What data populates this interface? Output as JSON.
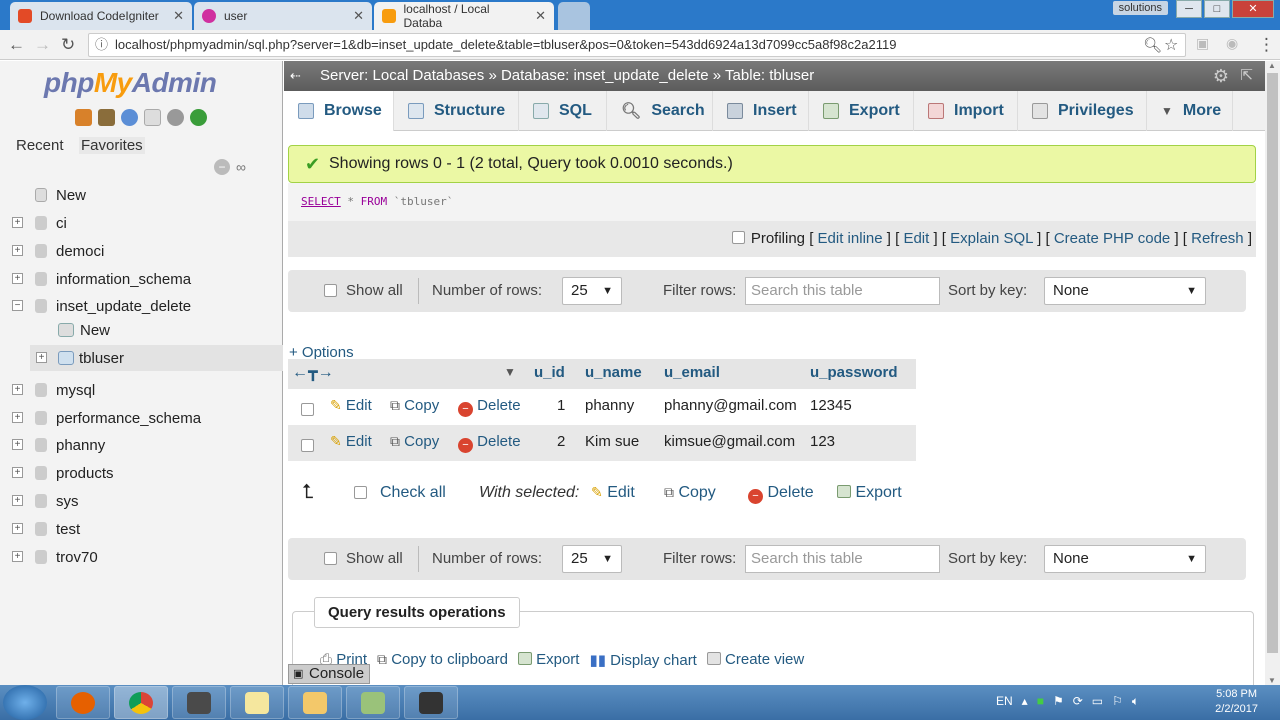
{
  "browser": {
    "tabs": [
      {
        "title": "Download CodeIgniter",
        "icon": "flame-icon",
        "color": "#e34a26",
        "active": false
      },
      {
        "title": "user",
        "icon": "wamp-icon",
        "color": "#d030a0",
        "active": false
      },
      {
        "title": "localhost / Local Databa",
        "icon": "phpmyadmin-icon",
        "color": "#f89c0e",
        "active": true
      }
    ],
    "profile_label": "solutions",
    "url": "localhost/phpmyadmin/sql.php?server=1&db=inset_update_delete&table=tbluser&pos=0&token=543dd6924a13d7099cc5a8f98c2a2119"
  },
  "left": {
    "logo_php": "php",
    "logo_my": "My",
    "logo_admin": "Admin",
    "tab_recent": "Recent",
    "tab_favorites": "Favorites",
    "tree": [
      {
        "label": "New",
        "type": "new"
      },
      {
        "label": "ci",
        "type": "db"
      },
      {
        "label": "democi",
        "type": "db"
      },
      {
        "label": "information_schema",
        "type": "db"
      },
      {
        "label": "inset_update_delete",
        "type": "db-open"
      },
      {
        "label": "New",
        "type": "child-new"
      },
      {
        "label": "tbluser",
        "type": "child-table"
      },
      {
        "label": "mysql",
        "type": "db"
      },
      {
        "label": "performance_schema",
        "type": "db"
      },
      {
        "label": "phanny",
        "type": "db"
      },
      {
        "label": "products",
        "type": "db"
      },
      {
        "label": "sys",
        "type": "db"
      },
      {
        "label": "test",
        "type": "db"
      },
      {
        "label": "trov70",
        "type": "db"
      }
    ]
  },
  "breadcrumb": {
    "server": "Server: Local Databases",
    "sep1": "»",
    "database": "Database: inset_update_delete",
    "sep2": "»",
    "table": "Table: tbluser"
  },
  "menu": [
    {
      "label": "Browse",
      "icon": "browse-icon"
    },
    {
      "label": "Structure",
      "icon": "structure-icon"
    },
    {
      "label": "SQL",
      "icon": "sql-icon"
    },
    {
      "label": "Search",
      "icon": "search-icon"
    },
    {
      "label": "Insert",
      "icon": "insert-icon"
    },
    {
      "label": "Export",
      "icon": "export-icon"
    },
    {
      "label": "Import",
      "icon": "import-icon"
    },
    {
      "label": "Privileges",
      "icon": "privileges-icon"
    },
    {
      "label": "More",
      "icon": "chevron-down-icon"
    }
  ],
  "message": "Showing rows 0 - 1 (2 total, Query took 0.0010 seconds.)",
  "sql": {
    "kw": "SELECT",
    "star": " * ",
    "from": "FROM",
    "table": " `tbluser`"
  },
  "profiling": {
    "label": "Profiling",
    "links": [
      "Edit inline",
      "Edit",
      "Explain SQL",
      "Create PHP code",
      "Refresh"
    ]
  },
  "nav": {
    "show_all": "Show all",
    "num_rows_label": "Number of rows:",
    "num_rows_value": "25",
    "filter_label": "Filter rows:",
    "filter_placeholder": "Search this table",
    "sort_label": "Sort by key:",
    "sort_value": "None"
  },
  "options_link": "+ Options",
  "table": {
    "columns": [
      "u_id",
      "u_name",
      "u_email",
      "u_password"
    ],
    "action_edit": "Edit",
    "action_copy": "Copy",
    "action_delete": "Delete",
    "rows": [
      {
        "u_id": "1",
        "u_name": "phanny",
        "u_email": "phanny@gmail.com",
        "u_password": "12345"
      },
      {
        "u_id": "2",
        "u_name": "Kim sue",
        "u_email": "kimsue@gmail.com",
        "u_password": "123"
      }
    ]
  },
  "with_selected": {
    "check_all": "Check all",
    "label": "With selected:",
    "edit": "Edit",
    "copy": "Copy",
    "delete": "Delete",
    "export": "Export"
  },
  "qro": {
    "legend": "Query results operations",
    "print": "Print",
    "clipboard": "Copy to clipboard",
    "export": "Export",
    "chart": "Display chart",
    "view": "Create view"
  },
  "console": "Console",
  "taskbar": {
    "lang": "EN",
    "time": "5:08 PM",
    "date": "2/2/2017"
  }
}
